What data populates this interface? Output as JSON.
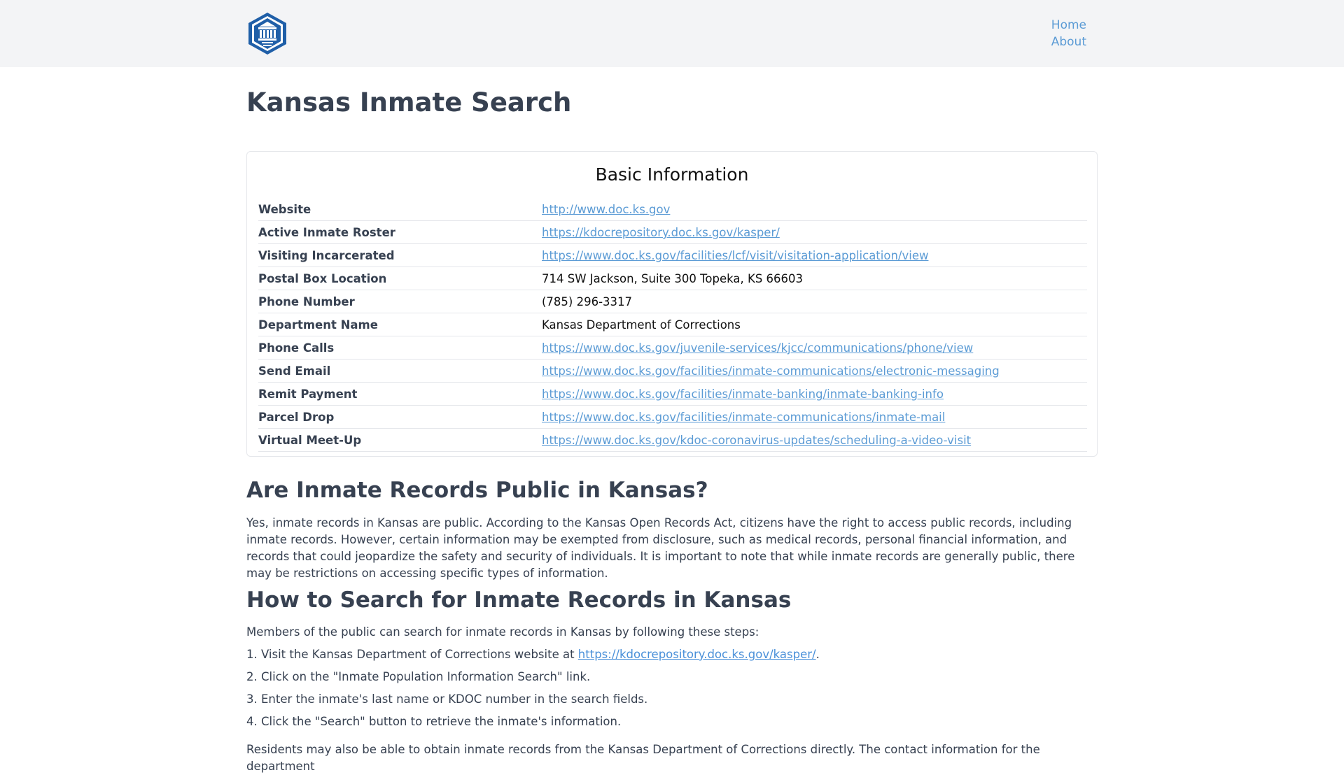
{
  "header": {
    "logo_alt": "Inmate search logo",
    "nav": [
      {
        "label": "Home"
      },
      {
        "label": "About"
      }
    ]
  },
  "page_title": "Kansas Inmate Search",
  "basic_info": {
    "title": "Basic Information",
    "rows": [
      {
        "label": "Website",
        "value": "http://www.doc.ks.gov",
        "is_link": true
      },
      {
        "label": "Active Inmate Roster",
        "value": "https://kdocrepository.doc.ks.gov/kasper/",
        "is_link": true
      },
      {
        "label": "Visiting Incarcerated",
        "value": "https://www.doc.ks.gov/facilities/lcf/visit/visitation-application/view",
        "is_link": true
      },
      {
        "label": "Postal Box Location",
        "value": "714 SW Jackson, Suite 300 Topeka, KS 66603",
        "is_link": false
      },
      {
        "label": "Phone Number",
        "value": "(785) 296-3317",
        "is_link": false
      },
      {
        "label": "Department Name",
        "value": "Kansas Department of Corrections",
        "is_link": false
      },
      {
        "label": "Phone Calls",
        "value": "https://www.doc.ks.gov/juvenile-services/kjcc/communications/phone/view",
        "is_link": true
      },
      {
        "label": "Send Email",
        "value": "https://www.doc.ks.gov/facilities/inmate-communications/electronic-messaging",
        "is_link": true
      },
      {
        "label": "Remit Payment",
        "value": "https://www.doc.ks.gov/facilities/inmate-banking/inmate-banking-info",
        "is_link": true
      },
      {
        "label": "Parcel Drop",
        "value": "https://www.doc.ks.gov/facilities/inmate-communications/inmate-mail",
        "is_link": true
      },
      {
        "label": "Virtual Meet-Up",
        "value": "https://www.doc.ks.gov/kdoc-coronavirus-updates/scheduling-a-video-visit",
        "is_link": true
      }
    ]
  },
  "section_public": {
    "heading": "Are Inmate Records Public in Kansas?",
    "body": "Yes, inmate records in Kansas are public. According to the Kansas Open Records Act, citizens have the right to access public records, including inmate records. However, certain information may be exempted from disclosure, such as medical records, personal financial information, and records that could jeopardize the safety and security of individuals. It is important to note that while inmate records are generally public, there may be restrictions on accessing specific types of information."
  },
  "section_search": {
    "heading": "How to Search for Inmate Records in Kansas",
    "intro": "Members of the public can search for inmate records in Kansas by following these steps:",
    "step1_prefix": "1. Visit the Kansas Department of Corrections website at ",
    "step1_link": "https://kdocrepository.doc.ks.gov/kasper/",
    "step1_suffix": ".",
    "step2": "2. Click on the \"Inmate Population Information Search\" link.",
    "step3": "3. Enter the inmate's last name or KDOC number in the search fields.",
    "step4": "4. Click the \"Search\" button to retrieve the inmate's information.",
    "outro": "Residents may also be able to obtain inmate records from the Kansas Department of Corrections directly. The contact information for the department"
  },
  "colors": {
    "link": "#5b9bd5",
    "header_bg": "#f3f4f6",
    "logo_blue": "#1f5fa8"
  }
}
